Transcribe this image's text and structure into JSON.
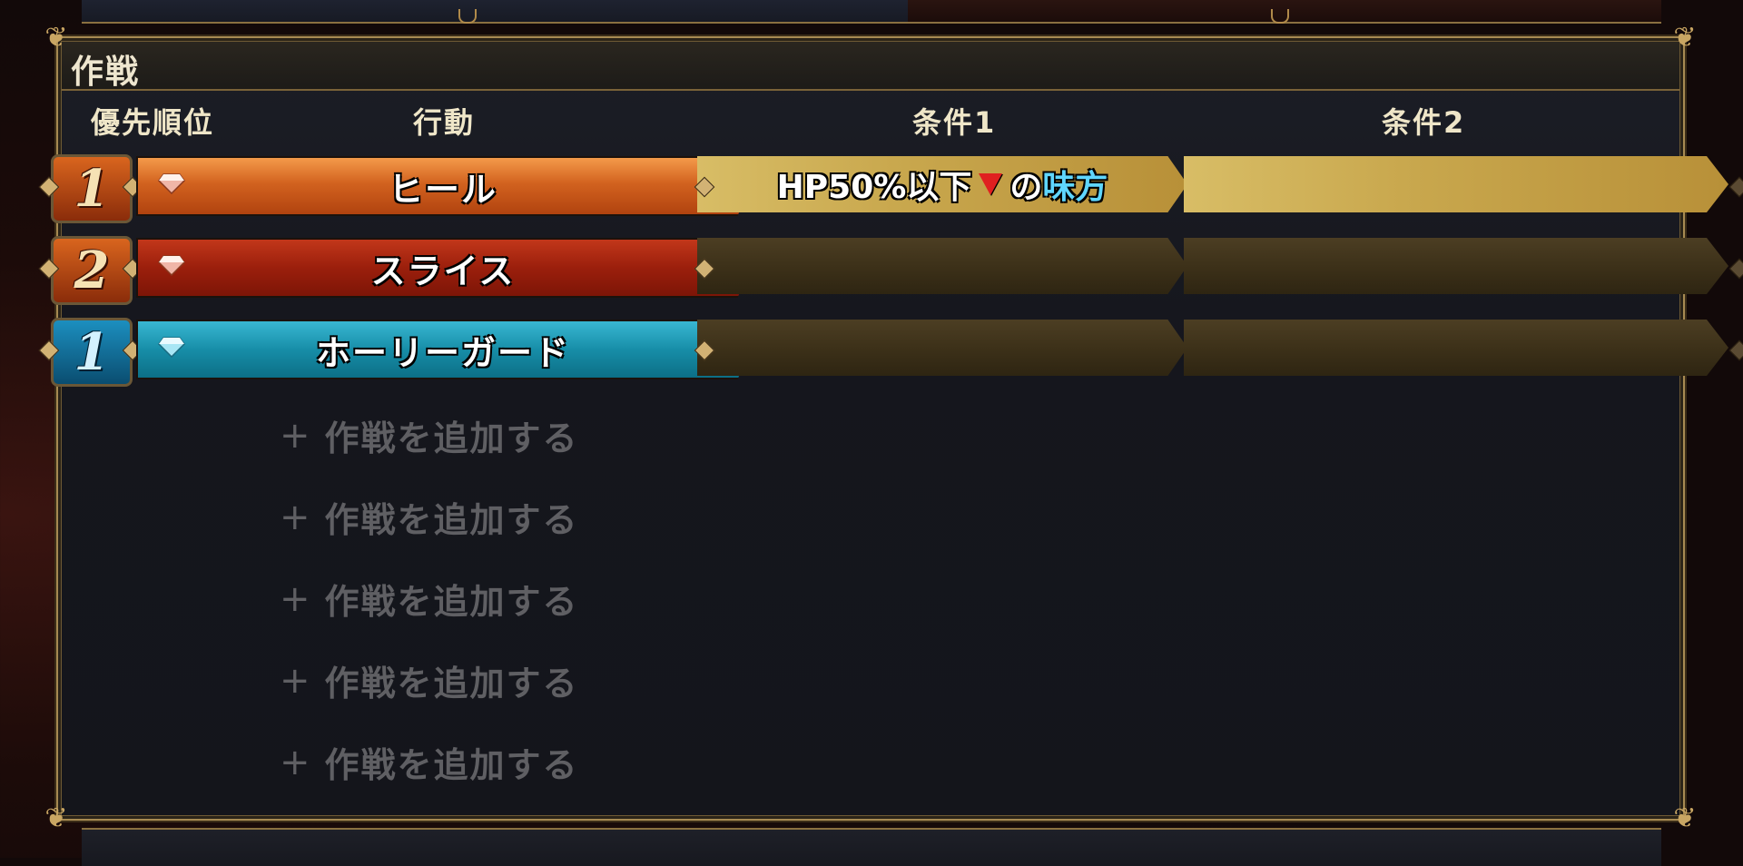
{
  "panel": {
    "title": "作戦"
  },
  "headers": {
    "priority": "優先順位",
    "action": "行動",
    "condition1": "条件1",
    "condition2": "条件2"
  },
  "rows": [
    {
      "priority": "1",
      "priority_color": "#d2621f",
      "gem_color": "#f0b6a8",
      "action": "ヒール",
      "action_color": "#d2621f",
      "condition1": {
        "text": "HP50%以下",
        "operator_icon": "down-triangle-icon",
        "particle": "の",
        "target": "味方"
      },
      "condition2": ""
    },
    {
      "priority": "2",
      "priority_color": "#d2621f",
      "gem_color": "#f0b6a8",
      "action": "スライス",
      "action_color": "#9b1f0c",
      "condition1": "",
      "condition2": ""
    },
    {
      "priority": "1",
      "priority_color": "#178ea8",
      "gem_color": "#a8e6f5",
      "action": "ホーリーガード",
      "action_color": "#178ea8",
      "condition1": "",
      "condition2": ""
    }
  ],
  "add_slots": [
    "作戦を追加する",
    "作戦を追加する",
    "作戦を追加する",
    "作戦を追加する",
    "作戦を追加する"
  ],
  "add_icon": "plus-icon",
  "colors": {
    "frame_gold": "#a78a52",
    "condition_active": "#c9a84e",
    "ally_text": "#5fd6ff",
    "triangle": "#e02020"
  }
}
